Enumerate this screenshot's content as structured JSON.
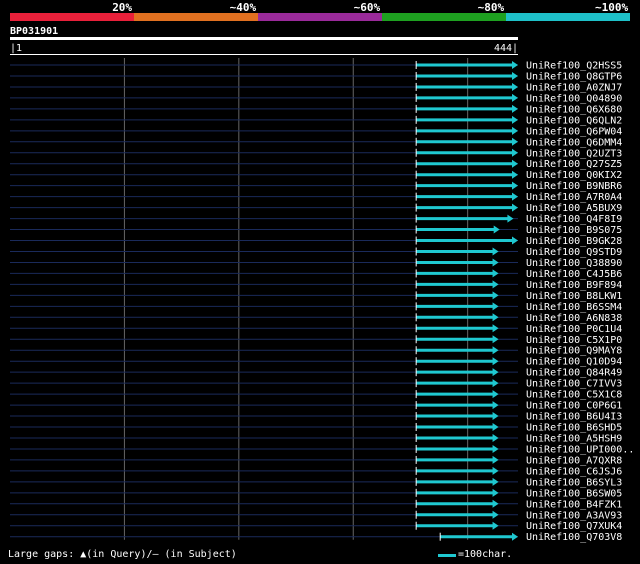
{
  "colorbar": {
    "segments": [
      {
        "color": "#e8203a",
        "label": "20%"
      },
      {
        "color": "#e07020",
        "label": "~40%"
      },
      {
        "color": "#9a2a9a",
        "label": "~60%"
      },
      {
        "color": "#1ea020",
        "label": "~80%"
      },
      {
        "color": "#1ec0c8",
        "label": "~100%"
      }
    ]
  },
  "query": {
    "id": "BP031901",
    "start": "|1",
    "end": "444|",
    "length": 444
  },
  "colors": {
    "hit": "#1fc8d0",
    "nohit": "#1a2a5a",
    "grid": "#666666"
  },
  "hits": [
    {
      "label": "UniRef100_Q2HSS5",
      "start": 355,
      "end": 444,
      "arrow": true
    },
    {
      "label": "UniRef100_Q8GTP6",
      "start": 355,
      "end": 444,
      "arrow": true
    },
    {
      "label": "UniRef100_A0ZNJ7",
      "start": 355,
      "end": 444,
      "arrow": true
    },
    {
      "label": "UniRef100_Q04890",
      "start": 355,
      "end": 444,
      "arrow": true
    },
    {
      "label": "UniRef100_Q6X680",
      "start": 355,
      "end": 444,
      "arrow": true
    },
    {
      "label": "UniRef100_Q6QLN2",
      "start": 355,
      "end": 444,
      "arrow": true
    },
    {
      "label": "UniRef100_Q6PW04",
      "start": 355,
      "end": 444,
      "arrow": true
    },
    {
      "label": "UniRef100_Q6DMM4",
      "start": 355,
      "end": 444,
      "arrow": true
    },
    {
      "label": "UniRef100_Q2UZT3",
      "start": 355,
      "end": 444,
      "arrow": true
    },
    {
      "label": "UniRef100_Q27SZ5",
      "start": 355,
      "end": 444,
      "arrow": true
    },
    {
      "label": "UniRef100_Q0KIX2",
      "start": 355,
      "end": 444,
      "arrow": true
    },
    {
      "label": "UniRef100_B9NBR6",
      "start": 355,
      "end": 444,
      "arrow": true
    },
    {
      "label": "UniRef100_A7R0A4",
      "start": 355,
      "end": 444,
      "arrow": true
    },
    {
      "label": "UniRef100_A5BUX9",
      "start": 355,
      "end": 444,
      "arrow": true
    },
    {
      "label": "UniRef100_Q4F8I9",
      "start": 355,
      "end": 440,
      "arrow": true
    },
    {
      "label": "UniRef100_B9S075",
      "start": 355,
      "end": 428,
      "arrow": true
    },
    {
      "label": "UniRef100_B9GK28",
      "start": 355,
      "end": 444,
      "arrow": true
    },
    {
      "label": "UniRef100_Q9STD9",
      "start": 355,
      "end": 427,
      "arrow": true
    },
    {
      "label": "UniRef100_Q38890",
      "start": 355,
      "end": 427,
      "arrow": true
    },
    {
      "label": "UniRef100_C4J5B6",
      "start": 355,
      "end": 427,
      "arrow": true
    },
    {
      "label": "UniRef100_B9F894",
      "start": 355,
      "end": 427,
      "arrow": true
    },
    {
      "label": "UniRef100_B8LKW1",
      "start": 355,
      "end": 427,
      "arrow": true
    },
    {
      "label": "UniRef100_B6SSM4",
      "start": 355,
      "end": 427,
      "arrow": true
    },
    {
      "label": "UniRef100_A6N838",
      "start": 355,
      "end": 427,
      "arrow": true
    },
    {
      "label": "UniRef100_P0C1U4",
      "start": 355,
      "end": 427,
      "arrow": true
    },
    {
      "label": "UniRef100_C5X1P0",
      "start": 355,
      "end": 427,
      "arrow": true
    },
    {
      "label": "UniRef100_Q9MAY8",
      "start": 355,
      "end": 427,
      "arrow": true
    },
    {
      "label": "UniRef100_Q10D94",
      "start": 355,
      "end": 427,
      "arrow": true
    },
    {
      "label": "UniRef100_Q84R49",
      "start": 355,
      "end": 427,
      "arrow": true
    },
    {
      "label": "UniRef100_C7IVV3",
      "start": 355,
      "end": 427,
      "arrow": true
    },
    {
      "label": "UniRef100_C5X1C8",
      "start": 355,
      "end": 427,
      "arrow": true
    },
    {
      "label": "UniRef100_C0P6G1",
      "start": 355,
      "end": 427,
      "arrow": true
    },
    {
      "label": "UniRef100_B6U4I3",
      "start": 355,
      "end": 427,
      "arrow": true
    },
    {
      "label": "UniRef100_B6SHD5",
      "start": 355,
      "end": 427,
      "arrow": true
    },
    {
      "label": "UniRef100_A5HSH9",
      "start": 355,
      "end": 427,
      "arrow": true
    },
    {
      "label": "UniRef100_UPI000..",
      "start": 355,
      "end": 427,
      "arrow": true
    },
    {
      "label": "UniRef100_A7QXR8",
      "start": 355,
      "end": 427,
      "arrow": true
    },
    {
      "label": "UniRef100_C6JSJ6",
      "start": 355,
      "end": 427,
      "arrow": true
    },
    {
      "label": "UniRef100_B6SYL3",
      "start": 355,
      "end": 427,
      "arrow": true
    },
    {
      "label": "UniRef100_B6SW05",
      "start": 355,
      "end": 427,
      "arrow": true
    },
    {
      "label": "UniRef100_B4FZK1",
      "start": 355,
      "end": 427,
      "arrow": true
    },
    {
      "label": "UniRef100_A3AV93",
      "start": 355,
      "end": 427,
      "arrow": true
    },
    {
      "label": "UniRef100_Q7XUK4",
      "start": 355,
      "end": 427,
      "arrow": true
    },
    {
      "label": "UniRef100_Q703V8",
      "start": 376,
      "end": 444,
      "arrow": true
    }
  ],
  "footer": {
    "gaps": "Large gaps: ▲(in Query)/— (in Subject)",
    "scale_label": "=100char."
  }
}
